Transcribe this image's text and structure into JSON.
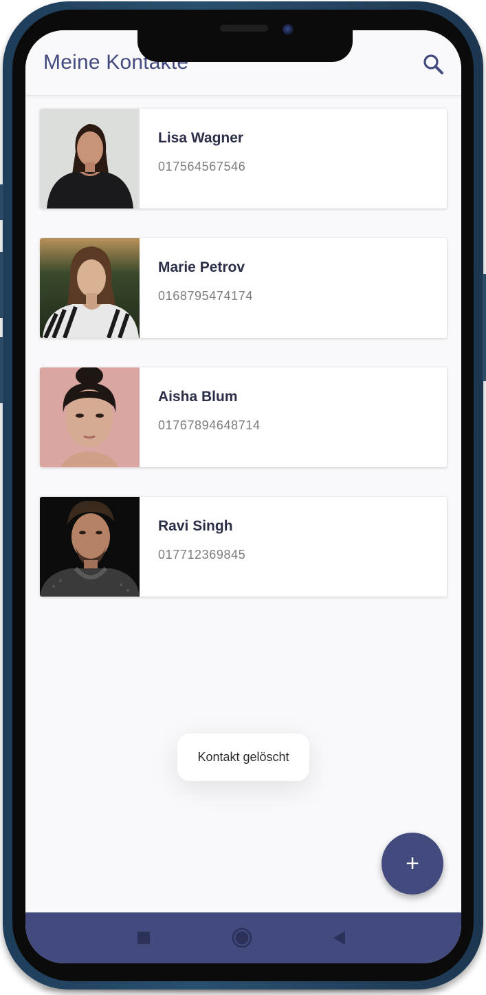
{
  "app_bar": {
    "title": "Meine Kontakte",
    "search_icon": "search-icon"
  },
  "contacts": [
    {
      "name": "Lisa Wagner",
      "phone": "017564567546"
    },
    {
      "name": "Marie Petrov",
      "phone": "0168795474174"
    },
    {
      "name": "Aisha Blum",
      "phone": "01767894648714"
    },
    {
      "name": "Ravi Singh",
      "phone": "017712369845"
    }
  ],
  "toast": {
    "message": "Kontakt gelöscht"
  },
  "fab": {
    "icon": "plus-icon",
    "label": "+"
  },
  "nav": {
    "recents_icon": "square-icon",
    "home_icon": "circle-icon",
    "back_icon": "triangle-back-icon"
  },
  "colors": {
    "primary": "#434a7e",
    "background": "#f9f9fb",
    "card": "#ffffff",
    "name_text": "#2b2e47",
    "phone_text": "#7b7b80"
  }
}
